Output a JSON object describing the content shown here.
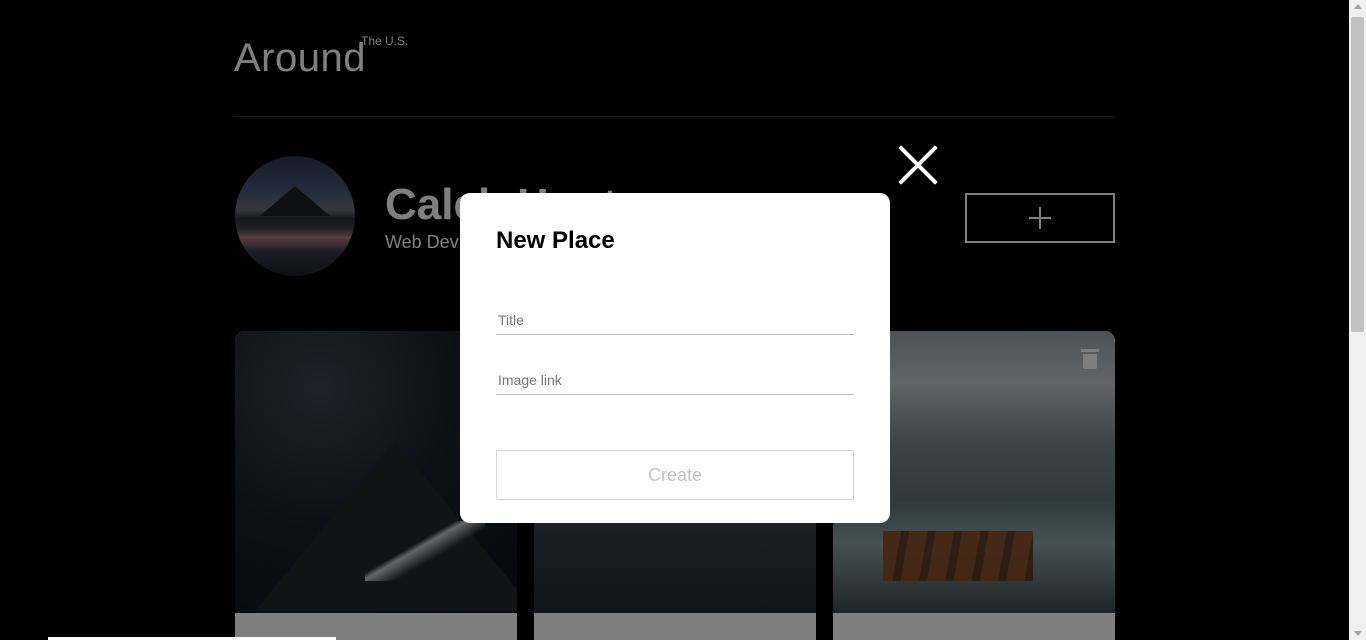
{
  "header": {
    "logo": "Around",
    "logo_sup": "The U.S."
  },
  "profile": {
    "name": "Caleb Hunt",
    "job": "Web Dev"
  },
  "icons": {
    "add": "plus-icon",
    "close": "close-icon",
    "delete": "trash-icon"
  },
  "modal": {
    "title": "New Place",
    "title_placeholder": "Title",
    "link_placeholder": "Image link",
    "submit_label": "Create"
  }
}
